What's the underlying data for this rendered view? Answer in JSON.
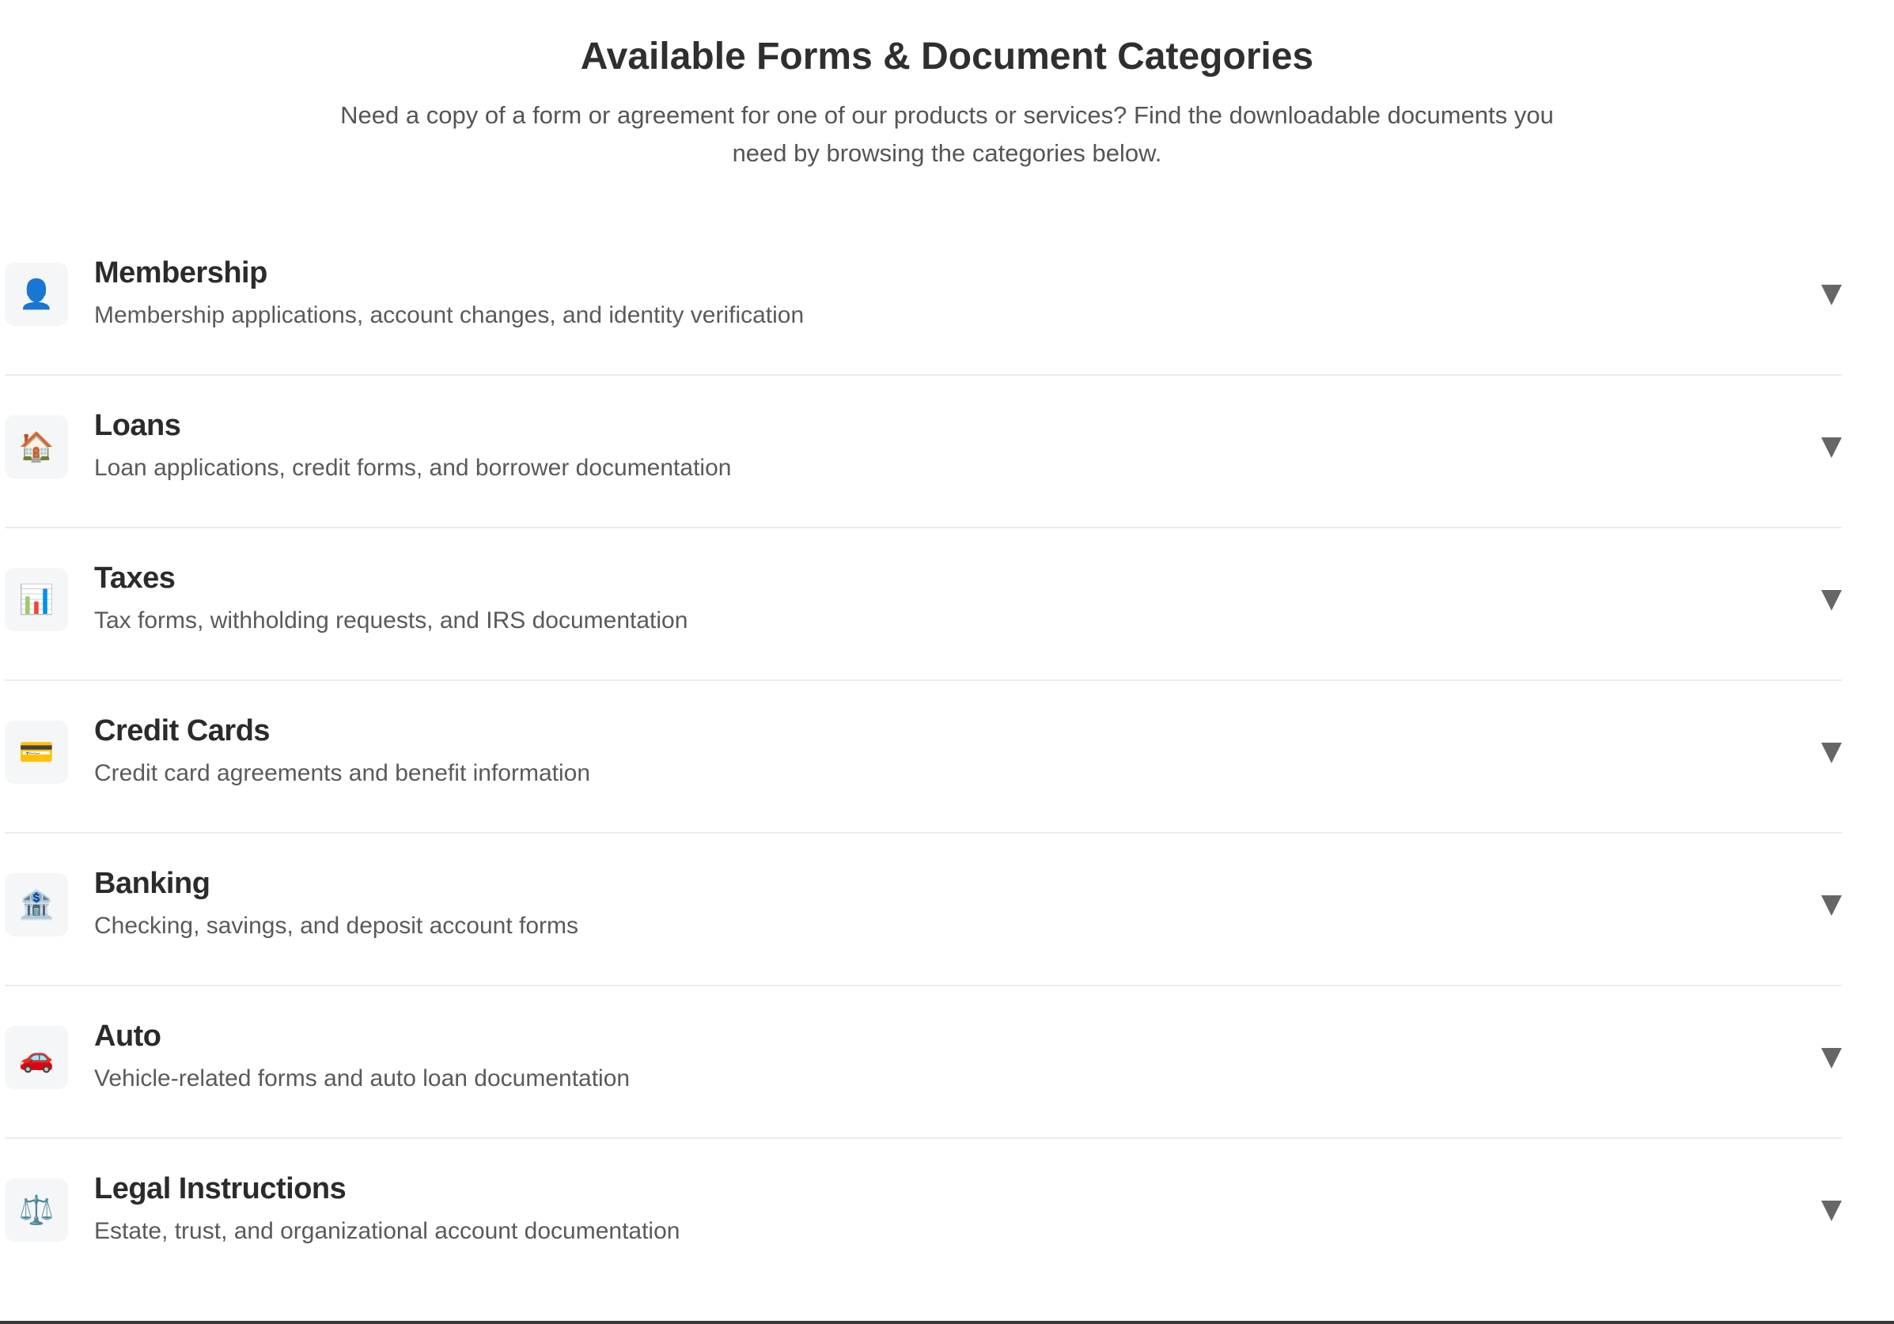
{
  "header": {
    "title": "Available Forms & Document Categories",
    "subtitle": "Need a copy of a form or agreement for one of our products or services? Find the downloadable documents you need by browsing the categories below."
  },
  "categories": [
    {
      "icon": "person-silhouette-icon",
      "glyph": "👤",
      "title": "Membership",
      "description": "Membership applications, account changes, and identity verification"
    },
    {
      "icon": "house-icon",
      "glyph": "🏠",
      "title": "Loans",
      "description": "Loan applications, credit forms, and borrower documentation"
    },
    {
      "icon": "bar-chart-icon",
      "glyph": "📊",
      "title": "Taxes",
      "description": "Tax forms, withholding requests, and IRS documentation"
    },
    {
      "icon": "credit-card-icon",
      "glyph": "💳",
      "title": "Credit Cards",
      "description": "Credit card agreements and benefit information"
    },
    {
      "icon": "bank-icon",
      "glyph": "🏦",
      "title": "Banking",
      "description": "Checking, savings, and deposit account forms"
    },
    {
      "icon": "car-icon",
      "glyph": "🚗",
      "title": "Auto",
      "description": "Vehicle-related forms and auto loan documentation"
    },
    {
      "icon": "scales-icon",
      "glyph": "⚖️",
      "title": "Legal Instructions",
      "description": "Estate, trust, and organizational account documentation"
    }
  ],
  "colors": {
    "title": "#2f2f2f",
    "text_muted": "#5a5a5a",
    "divider": "#ececec",
    "icon_bg": "#f5f6f7",
    "chevron": "#666666"
  }
}
